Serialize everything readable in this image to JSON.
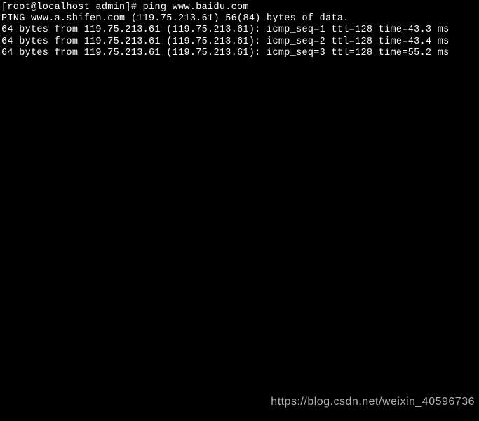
{
  "terminal": {
    "prompt": "[root@localhost admin]# ",
    "command": "ping www.baidu.com",
    "header": "PING www.a.shifen.com (119.75.213.61) 56(84) bytes of data.",
    "replies": [
      "64 bytes from 119.75.213.61 (119.75.213.61): icmp_seq=1 ttl=128 time=43.3 ms",
      "64 bytes from 119.75.213.61 (119.75.213.61): icmp_seq=2 ttl=128 time=43.4 ms",
      "64 bytes from 119.75.213.61 (119.75.213.61): icmp_seq=3 ttl=128 time=55.2 ms"
    ]
  },
  "watermark": "https://blog.csdn.net/weixin_40596736"
}
